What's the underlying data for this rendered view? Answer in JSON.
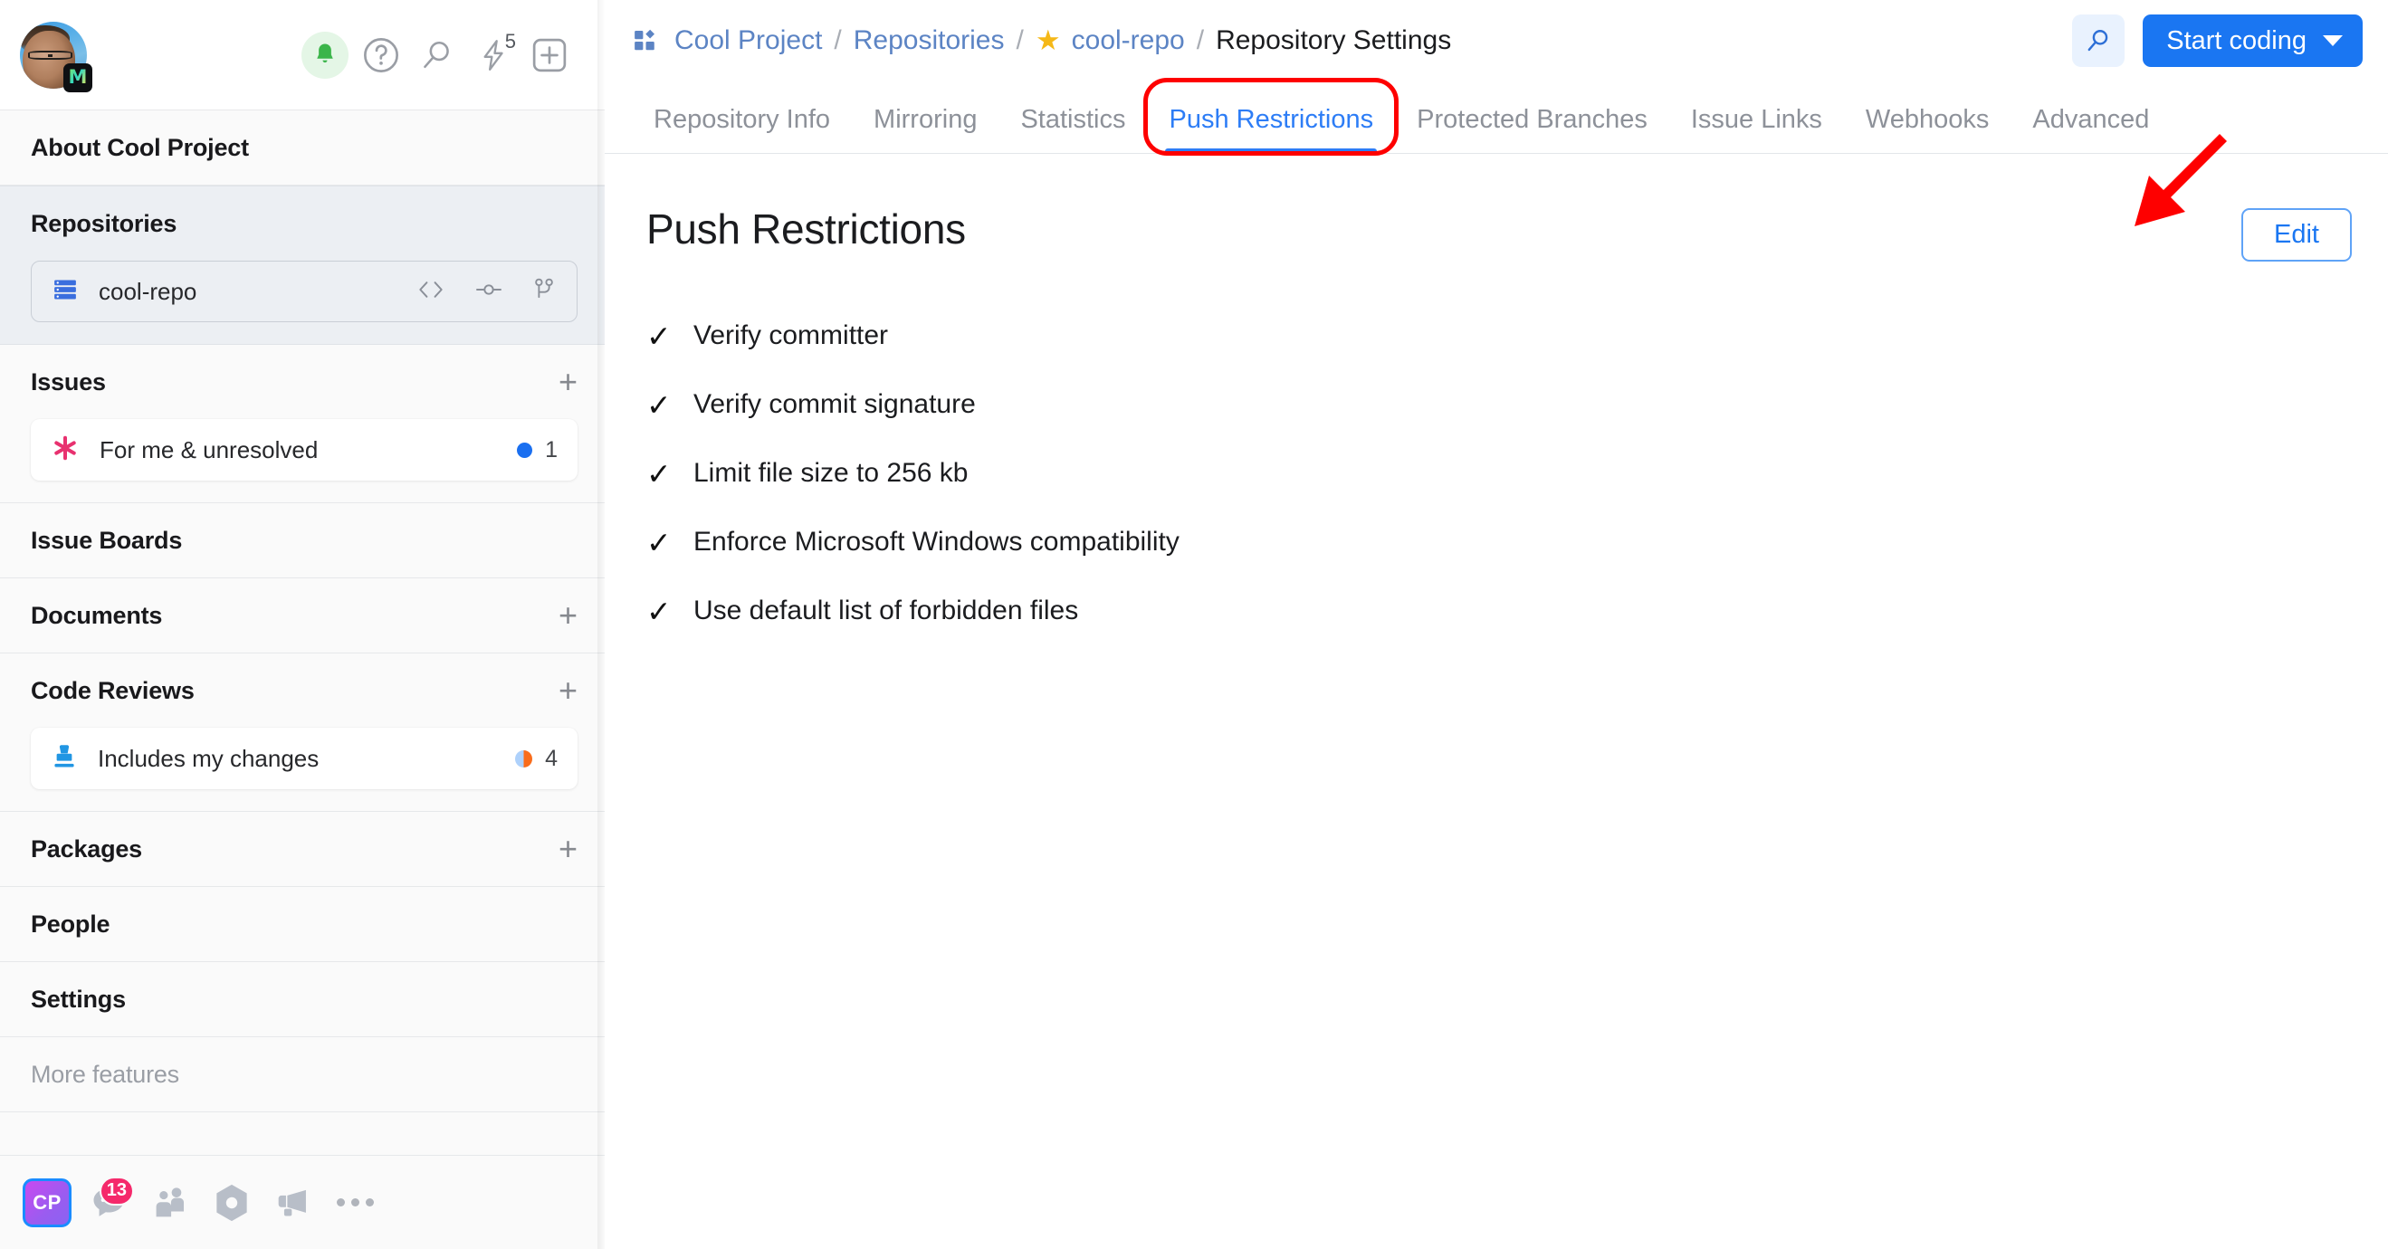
{
  "sidebar": {
    "user": {
      "avatar_badge": "M",
      "avatar_name": "user-photo"
    },
    "top_icons": [
      {
        "name": "notifications-bell-icon",
        "glyph": "bell"
      },
      {
        "name": "help-icon",
        "glyph": "?"
      },
      {
        "name": "search-icon",
        "glyph": "search"
      },
      {
        "name": "quick-actions-lightning-icon",
        "glyph": "lightning",
        "badge": "5"
      },
      {
        "name": "new-item-plus-icon",
        "glyph": "plus-box"
      }
    ],
    "about": {
      "label": "About Cool Project"
    },
    "sections": [
      {
        "key": "repositories",
        "label": "Repositories",
        "has_plus": false,
        "highlight": true,
        "items": [
          {
            "label": "cool-repo",
            "icon": "repository-icon",
            "style": "outlined",
            "actions": [
              "code-icon",
              "commits-icon",
              "branches-icon"
            ]
          }
        ]
      },
      {
        "key": "issues",
        "label": "Issues",
        "has_plus": true,
        "highlight": false,
        "items": [
          {
            "label": "For me & unresolved",
            "icon": "issue-asterisk-icon",
            "count": "1",
            "badge": "dot-blue"
          }
        ]
      },
      {
        "key": "issue-boards",
        "label": "Issue Boards",
        "has_plus": false,
        "highlight": false,
        "items": []
      },
      {
        "key": "documents",
        "label": "Documents",
        "has_plus": true,
        "highlight": false,
        "items": []
      },
      {
        "key": "code-reviews",
        "label": "Code Reviews",
        "has_plus": true,
        "highlight": false,
        "items": [
          {
            "label": "Includes my changes",
            "icon": "code-review-stamp-icon",
            "count": "4",
            "badge": "dot-split"
          }
        ]
      },
      {
        "key": "packages",
        "label": "Packages",
        "has_plus": true,
        "highlight": false,
        "items": []
      },
      {
        "key": "people",
        "label": "People",
        "has_plus": false,
        "highlight": false,
        "items": []
      },
      {
        "key": "settings",
        "label": "Settings",
        "has_plus": false,
        "highlight": false,
        "items": []
      },
      {
        "key": "more-features",
        "label": "More features",
        "has_plus": false,
        "highlight": false,
        "muted": true,
        "items": []
      }
    ],
    "footer": [
      {
        "name": "project-avatar-cp",
        "label": "CP",
        "type": "tile"
      },
      {
        "name": "chats-icon",
        "badge": "13",
        "type": "icon"
      },
      {
        "name": "teams-icon",
        "type": "icon"
      },
      {
        "name": "packages-hexagon-icon",
        "type": "icon"
      },
      {
        "name": "blog-megaphone-icon",
        "type": "icon"
      },
      {
        "name": "more-options-icon",
        "type": "icon"
      }
    ]
  },
  "header": {
    "breadcrumb": [
      {
        "label": "Cool Project",
        "link": true,
        "icon": "project-icon"
      },
      {
        "label": "Repositories",
        "link": true
      },
      {
        "label": "cool-repo",
        "link": true,
        "starred": true
      },
      {
        "label": "Repository Settings",
        "link": false
      }
    ],
    "separator": "/",
    "search_icon": "search-icon",
    "start_coding_label": "Start coding",
    "accent_blue": "#1a76f2",
    "star_color": "#f5b817"
  },
  "tabs": {
    "items": [
      {
        "label": "Repository Info",
        "active": false
      },
      {
        "label": "Mirroring",
        "active": false
      },
      {
        "label": "Statistics",
        "active": false
      },
      {
        "label": "Push Restrictions",
        "active": true
      },
      {
        "label": "Protected Branches",
        "active": false
      },
      {
        "label": "Issue Links",
        "active": false
      },
      {
        "label": "Webhooks",
        "active": false
      },
      {
        "label": "Advanced",
        "active": false
      }
    ],
    "highlight_color": "#fe0000",
    "highlighted_tab": "Push Restrictions"
  },
  "main": {
    "title": "Push Restrictions",
    "edit_label": "Edit",
    "check_glyph": "✓",
    "restrictions": [
      {
        "label": "Verify committer",
        "checked": true
      },
      {
        "label": "Verify commit signature",
        "checked": true
      },
      {
        "label": "Limit file size to 256 kb",
        "checked": true
      },
      {
        "label": "Enforce Microsoft Windows compatibility",
        "checked": true
      },
      {
        "label": "Use default list of forbidden files",
        "checked": true
      }
    ],
    "annotation_arrow": {
      "color": "#fe0000",
      "points_to": "edit-button"
    }
  }
}
